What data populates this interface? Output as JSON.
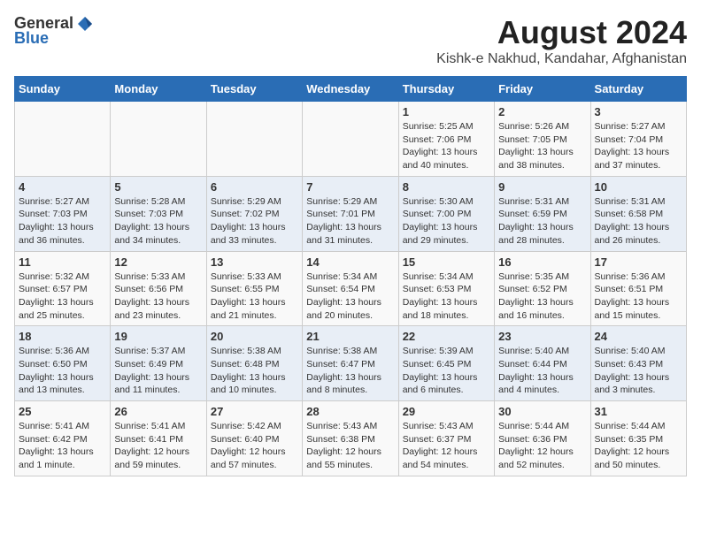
{
  "logo": {
    "general": "General",
    "blue": "Blue"
  },
  "title": "August 2024",
  "subtitle": "Kishk-e Nakhud, Kandahar, Afghanistan",
  "days_of_week": [
    "Sunday",
    "Monday",
    "Tuesday",
    "Wednesday",
    "Thursday",
    "Friday",
    "Saturday"
  ],
  "weeks": [
    [
      {
        "day": "",
        "info": ""
      },
      {
        "day": "",
        "info": ""
      },
      {
        "day": "",
        "info": ""
      },
      {
        "day": "",
        "info": ""
      },
      {
        "day": "1",
        "info": "Sunrise: 5:25 AM\nSunset: 7:06 PM\nDaylight: 13 hours\nand 40 minutes."
      },
      {
        "day": "2",
        "info": "Sunrise: 5:26 AM\nSunset: 7:05 PM\nDaylight: 13 hours\nand 38 minutes."
      },
      {
        "day": "3",
        "info": "Sunrise: 5:27 AM\nSunset: 7:04 PM\nDaylight: 13 hours\nand 37 minutes."
      }
    ],
    [
      {
        "day": "4",
        "info": "Sunrise: 5:27 AM\nSunset: 7:03 PM\nDaylight: 13 hours\nand 36 minutes."
      },
      {
        "day": "5",
        "info": "Sunrise: 5:28 AM\nSunset: 7:03 PM\nDaylight: 13 hours\nand 34 minutes."
      },
      {
        "day": "6",
        "info": "Sunrise: 5:29 AM\nSunset: 7:02 PM\nDaylight: 13 hours\nand 33 minutes."
      },
      {
        "day": "7",
        "info": "Sunrise: 5:29 AM\nSunset: 7:01 PM\nDaylight: 13 hours\nand 31 minutes."
      },
      {
        "day": "8",
        "info": "Sunrise: 5:30 AM\nSunset: 7:00 PM\nDaylight: 13 hours\nand 29 minutes."
      },
      {
        "day": "9",
        "info": "Sunrise: 5:31 AM\nSunset: 6:59 PM\nDaylight: 13 hours\nand 28 minutes."
      },
      {
        "day": "10",
        "info": "Sunrise: 5:31 AM\nSunset: 6:58 PM\nDaylight: 13 hours\nand 26 minutes."
      }
    ],
    [
      {
        "day": "11",
        "info": "Sunrise: 5:32 AM\nSunset: 6:57 PM\nDaylight: 13 hours\nand 25 minutes."
      },
      {
        "day": "12",
        "info": "Sunrise: 5:33 AM\nSunset: 6:56 PM\nDaylight: 13 hours\nand 23 minutes."
      },
      {
        "day": "13",
        "info": "Sunrise: 5:33 AM\nSunset: 6:55 PM\nDaylight: 13 hours\nand 21 minutes."
      },
      {
        "day": "14",
        "info": "Sunrise: 5:34 AM\nSunset: 6:54 PM\nDaylight: 13 hours\nand 20 minutes."
      },
      {
        "day": "15",
        "info": "Sunrise: 5:34 AM\nSunset: 6:53 PM\nDaylight: 13 hours\nand 18 minutes."
      },
      {
        "day": "16",
        "info": "Sunrise: 5:35 AM\nSunset: 6:52 PM\nDaylight: 13 hours\nand 16 minutes."
      },
      {
        "day": "17",
        "info": "Sunrise: 5:36 AM\nSunset: 6:51 PM\nDaylight: 13 hours\nand 15 minutes."
      }
    ],
    [
      {
        "day": "18",
        "info": "Sunrise: 5:36 AM\nSunset: 6:50 PM\nDaylight: 13 hours\nand 13 minutes."
      },
      {
        "day": "19",
        "info": "Sunrise: 5:37 AM\nSunset: 6:49 PM\nDaylight: 13 hours\nand 11 minutes."
      },
      {
        "day": "20",
        "info": "Sunrise: 5:38 AM\nSunset: 6:48 PM\nDaylight: 13 hours\nand 10 minutes."
      },
      {
        "day": "21",
        "info": "Sunrise: 5:38 AM\nSunset: 6:47 PM\nDaylight: 13 hours\nand 8 minutes."
      },
      {
        "day": "22",
        "info": "Sunrise: 5:39 AM\nSunset: 6:45 PM\nDaylight: 13 hours\nand 6 minutes."
      },
      {
        "day": "23",
        "info": "Sunrise: 5:40 AM\nSunset: 6:44 PM\nDaylight: 13 hours\nand 4 minutes."
      },
      {
        "day": "24",
        "info": "Sunrise: 5:40 AM\nSunset: 6:43 PM\nDaylight: 13 hours\nand 3 minutes."
      }
    ],
    [
      {
        "day": "25",
        "info": "Sunrise: 5:41 AM\nSunset: 6:42 PM\nDaylight: 13 hours\nand 1 minute."
      },
      {
        "day": "26",
        "info": "Sunrise: 5:41 AM\nSunset: 6:41 PM\nDaylight: 12 hours\nand 59 minutes."
      },
      {
        "day": "27",
        "info": "Sunrise: 5:42 AM\nSunset: 6:40 PM\nDaylight: 12 hours\nand 57 minutes."
      },
      {
        "day": "28",
        "info": "Sunrise: 5:43 AM\nSunset: 6:38 PM\nDaylight: 12 hours\nand 55 minutes."
      },
      {
        "day": "29",
        "info": "Sunrise: 5:43 AM\nSunset: 6:37 PM\nDaylight: 12 hours\nand 54 minutes."
      },
      {
        "day": "30",
        "info": "Sunrise: 5:44 AM\nSunset: 6:36 PM\nDaylight: 12 hours\nand 52 minutes."
      },
      {
        "day": "31",
        "info": "Sunrise: 5:44 AM\nSunset: 6:35 PM\nDaylight: 12 hours\nand 50 minutes."
      }
    ]
  ]
}
